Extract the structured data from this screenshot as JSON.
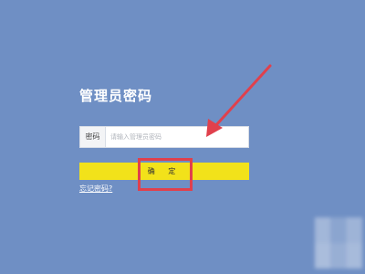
{
  "login": {
    "title": "管理员密码",
    "password_label": "密码",
    "password_placeholder": "请输入管理员密码",
    "confirm_label": "确 定",
    "forgot_link": "忘记密码?"
  },
  "colors": {
    "background": "#6f8fc4",
    "button": "#f2e21a",
    "annotation": "#e0404c"
  },
  "annotations": {
    "arrow": "arrow-icon",
    "highlight": "highlight-box"
  }
}
